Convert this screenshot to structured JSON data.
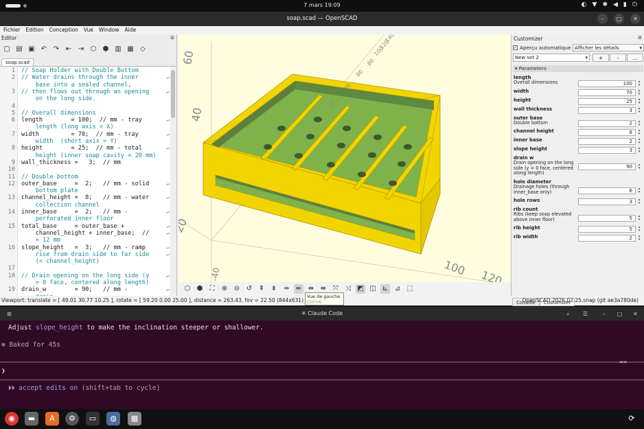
{
  "topbar": {
    "clock": "7 mars  19:09",
    "tray_icons": [
      "night-light-icon",
      "wifi-icon",
      "bluetooth-icon",
      "volume-icon",
      "battery-icon",
      "power-icon"
    ]
  },
  "window": {
    "title": "soap.scad — OpenSCAD"
  },
  "menu": [
    "Fichier",
    "Edition",
    "Conception",
    "Vue",
    "Window",
    "Aide"
  ],
  "editor": {
    "header": "Editor",
    "tab": "soap.scad",
    "lines": [
      {
        "n": "1",
        "t": "// Soap Holder with Double Bottom",
        "c": true,
        "w": false
      },
      {
        "n": "2",
        "t": "// Water drains through the inner",
        "c": true,
        "w": true
      },
      {
        "n": "",
        "t": "    base into a sealed channel,",
        "c": true,
        "w": false
      },
      {
        "n": "3",
        "t": "// then flows out through an opening",
        "c": true,
        "w": true
      },
      {
        "n": "",
        "t": "    on the long side.",
        "c": true,
        "w": false
      },
      {
        "n": "4",
        "t": "",
        "c": false,
        "w": false
      },
      {
        "n": "5",
        "t": "// Overall dimensions",
        "c": true,
        "w": false
      },
      {
        "n": "6",
        "t": "length        = 100;  // mm - tray",
        "c": false,
        "w": true
      },
      {
        "n": "",
        "t": "    length (long axis = X)",
        "c": true,
        "w": false
      },
      {
        "n": "7",
        "t": "width         = 70;  // mm - tray",
        "c": false,
        "w": true
      },
      {
        "n": "",
        "t": "    width  (short axis = Y)",
        "c": true,
        "w": false
      },
      {
        "n": "8",
        "t": "height        = 25;  // mm - total",
        "c": false,
        "w": true
      },
      {
        "n": "",
        "t": "    height (inner soap cavity = 20 mm)",
        "c": true,
        "w": false
      },
      {
        "n": "9",
        "t": "wall_thickness =   3;  // mm",
        "c": false,
        "w": false
      },
      {
        "n": "10",
        "t": "",
        "c": false,
        "w": false
      },
      {
        "n": "11",
        "t": "// Double bottom",
        "c": true,
        "w": false
      },
      {
        "n": "12",
        "t": "outer_base     =  2;   // mm - solid",
        "c": false,
        "w": true
      },
      {
        "n": "",
        "t": "    bottom plate",
        "c": true,
        "w": false
      },
      {
        "n": "13",
        "t": "channel_height =  8;   // mm - water",
        "c": false,
        "w": true
      },
      {
        "n": "",
        "t": "    collection channel",
        "c": true,
        "w": false
      },
      {
        "n": "14",
        "t": "inner_base     =  2;   // mm -",
        "c": false,
        "w": true
      },
      {
        "n": "",
        "t": "    perforated inner floor",
        "c": true,
        "w": false
      },
      {
        "n": "15",
        "t": "total_base     = outer_base +",
        "c": false,
        "w": true
      },
      {
        "n": "",
        "t": "    channel_height + inner_base;  //",
        "c": false,
        "w": true
      },
      {
        "n": "",
        "t": "    = 12 mm",
        "c": true,
        "w": false
      },
      {
        "n": "16",
        "t": "slope_height   =  3;   // mm - ramp",
        "c": false,
        "w": true
      },
      {
        "n": "",
        "t": "    rise from drain side to far side",
        "c": true,
        "w": true
      },
      {
        "n": "",
        "t": "    (< channel_height)",
        "c": true,
        "w": false
      },
      {
        "n": "17",
        "t": "",
        "c": false,
        "w": false
      },
      {
        "n": "18",
        "t": "// Drain opening on the long side (y",
        "c": true,
        "w": true
      },
      {
        "n": "",
        "t": "    = 0 face, centered along length)",
        "c": true,
        "w": false
      },
      {
        "n": "19",
        "t": "drain_w        = 90;   // mm -",
        "c": false,
        "w": true
      },
      {
        "n": "",
        "t": "    drain_",
        "c": true,
        "w": false
      }
    ]
  },
  "viewport": {
    "axis_labels": [
      "60",
      "40",
      "20",
      "-20",
      "-40",
      "20",
      "40",
      "60",
      "80",
      "100",
      "120",
      "20",
      "40",
      "60",
      "80",
      "100",
      "120",
      "140"
    ],
    "tooltip": {
      "title": "Vue de gauche",
      "shortcut": "Ctrl+6"
    }
  },
  "statusbar": {
    "left": "Viewport: translate = [ 49.01 30.77 10.25 ], rotate = [ 59.20 0.00 25.00 ], distance = 263.43, fov = 22.50 (844x631)",
    "right": "OpenSCAD 2026.02.25.snap (git ae3a780de)"
  },
  "customizer": {
    "header": "Customizer",
    "auto_preview": "Aperçu automatique",
    "detail": "Afficher les détails",
    "set": "New set 2",
    "add": "+",
    "remove": "-",
    "more": "...",
    "section": "Parameters",
    "params": [
      {
        "name": "length",
        "desc": "Overall dimensions",
        "value": "100"
      },
      {
        "name": "width",
        "desc": "",
        "value": "70"
      },
      {
        "name": "height",
        "desc": "",
        "value": "25"
      },
      {
        "name": "wall thickness",
        "desc": "",
        "value": "3"
      },
      {
        "name": "outer base",
        "desc": "Double bottom",
        "value": "2"
      },
      {
        "name": "channel height",
        "desc": "",
        "value": "8"
      },
      {
        "name": "inner base",
        "desc": "",
        "value": "2"
      },
      {
        "name": "slope height",
        "desc": "",
        "value": "3"
      },
      {
        "name": "drain w",
        "desc": "Drain opening on the long side (y = 0 face, centered along length)",
        "value": "90"
      },
      {
        "name": "hole diameter",
        "desc": "Drainage holes (through inner_base only)",
        "value": "6"
      },
      {
        "name": "hole rows",
        "desc": "",
        "value": "3"
      },
      {
        "name": "rib count",
        "desc": "Ribs (keep soap elevated above inner floor)",
        "value": "5"
      },
      {
        "name": "rib height",
        "desc": "",
        "value": "5"
      },
      {
        "name": "rib width",
        "desc": "",
        "value": "2"
      }
    ],
    "tabs": [
      "Console",
      "Customizer"
    ]
  },
  "terminal": {
    "title": "✳ Claude Code",
    "msg_pre": "Adjust ",
    "msg_code": "slope_height",
    "msg_post": " to make the inclination steeper or shallower.",
    "baked": "✻ Baked for 45s",
    "prompt": "❯",
    "mode_arrows": "⏵⏵",
    "mode": "accept edits on",
    "mode_hint": "(shift+tab to cycle)"
  },
  "colors": {
    "model_yellow": "#f2d400",
    "model_green": "#8dbf50",
    "terminal_bg": "#300a24",
    "viewport_bg": "#fffde0"
  }
}
